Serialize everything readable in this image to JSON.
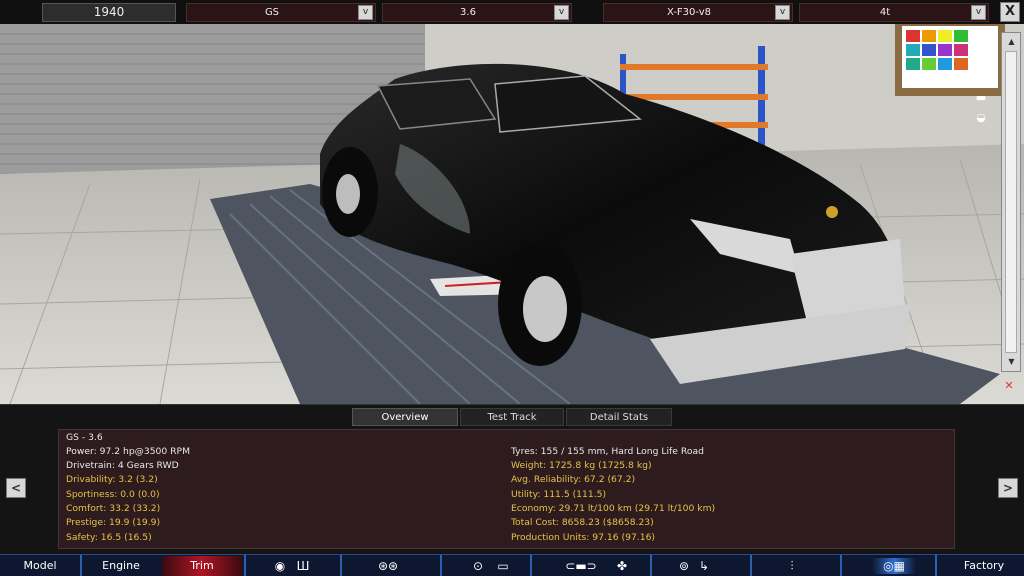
{
  "top": {
    "year": "1940",
    "selects": [
      {
        "label": "GS"
      },
      {
        "label": "3.6"
      },
      {
        "label": "X-F30-v8"
      },
      {
        "label": "4t"
      }
    ],
    "dropdown_glyph": "v",
    "close_label": "X"
  },
  "tabs": [
    "Overview",
    "Test Track",
    "Detail Stats"
  ],
  "stats": {
    "left": [
      {
        "text": "GS - 3.6",
        "color": "white"
      },
      {
        "text": "Power: 97.2 hp@3500 RPM",
        "color": "white"
      },
      {
        "text": "Drivetrain: 4 Gears RWD",
        "color": "white"
      },
      {
        "text": "Drivability: 3.2 (3.2)",
        "color": "yellow"
      },
      {
        "text": "Sportiness: 0.0 (0.0)",
        "color": "yellow"
      },
      {
        "text": "Comfort: 33.2 (33.2)",
        "color": "yellow"
      },
      {
        "text": "Prestige: 19.9 (19.9)",
        "color": "yellow"
      },
      {
        "text": "Safety: 16.5 (16.5)",
        "color": "yellow"
      }
    ],
    "right": [
      {
        "text": "Tyres: 155 / 155 mm, Hard Long Life Road",
        "color": "white"
      },
      {
        "text": "Weight: 1725.8 kg (1725.8 kg)",
        "color": "yellow"
      },
      {
        "text": "Avg. Reliability: 67.2 (67.2)",
        "color": "yellow"
      },
      {
        "text": "Utility: 111.5 (111.5)",
        "color": "yellow"
      },
      {
        "text": "Economy: 29.71 lt/100 km (29.71 lt/100 km)",
        "color": "yellow"
      },
      {
        "text": "Total Cost: 8658.23 ($8658.23)",
        "color": "yellow"
      },
      {
        "text": "Production Units: 97.16 (97.16)",
        "color": "yellow"
      }
    ]
  },
  "nav": {
    "prev": "<",
    "next": ">"
  },
  "bottom": {
    "model": "Model",
    "engine": "Engine",
    "trim": "Trim",
    "factory": "Factory",
    "icons": [
      "wheel-icon",
      "gearbox-icon",
      "brakes-icon",
      "tyre-icon",
      "body-icon",
      "car-icon",
      "fan-icon",
      "steering-icon",
      "seat-icon",
      "suspension-icon",
      "test-icon"
    ]
  },
  "colors": {
    "accent_red": "#b01525",
    "stat_yellow": "#e6c24a",
    "panel_bg": "#2d1b1d",
    "nav_blue": "#0e1730"
  }
}
